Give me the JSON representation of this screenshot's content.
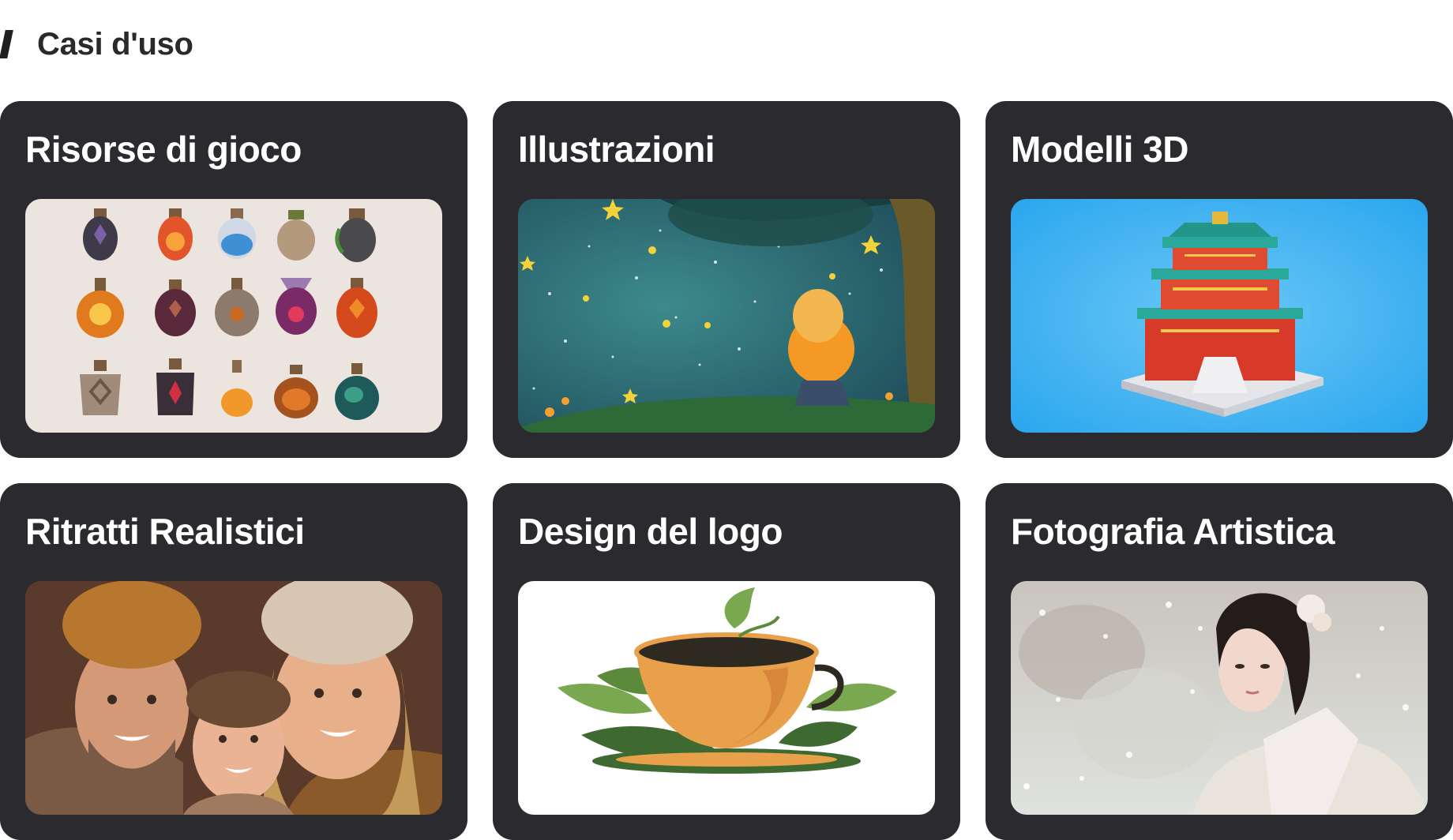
{
  "section": {
    "title": "Casi d'uso"
  },
  "cards": [
    {
      "title": "Risorse di gioco"
    },
    {
      "title": "Illustrazioni"
    },
    {
      "title": "Modelli 3D"
    },
    {
      "title": "Ritratti Realistici"
    },
    {
      "title": "Design del logo"
    },
    {
      "title": "Fotografia Artistica"
    }
  ]
}
